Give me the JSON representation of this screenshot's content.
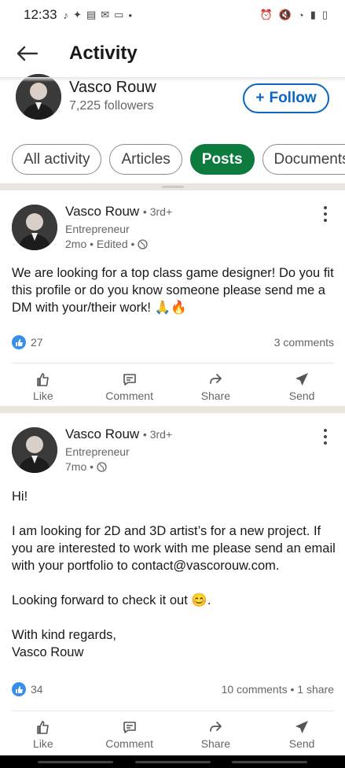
{
  "status_bar": {
    "time": "12:33"
  },
  "header": {
    "title": "Activity"
  },
  "profile": {
    "name": "Vasco Rouw",
    "followers": "7,225 followers",
    "follow_label": "Follow"
  },
  "filters": [
    {
      "label": "All activity",
      "active": false
    },
    {
      "label": "Articles",
      "active": false
    },
    {
      "label": "Posts",
      "active": true
    },
    {
      "label": "Documents",
      "active": false
    }
  ],
  "posts": [
    {
      "author": "Vasco Rouw",
      "degree": "• 3rd+",
      "headline": "Entrepreneur",
      "meta": "2mo • Edited •",
      "text": "We are looking for a top class game designer! Do you fit this profile or do you know someone please send me a DM with your/their work! 🙏🔥",
      "reactions": "27",
      "comments": "3 comments"
    },
    {
      "author": "Vasco Rouw",
      "degree": "• 3rd+",
      "headline": "Entrepreneur",
      "meta": "7mo •",
      "text": "Hi!\n\nI am looking for 2D and 3D artist’s for a new project. If you are interested to work with me please send an email with your portfolio to contact@vascorouw.com.\n\nLooking forward to check it out 😊.\n\nWith kind regards,\nVasco Rouw",
      "reactions": "34",
      "comments": "10 comments • 1 share"
    }
  ],
  "actions": {
    "like": "Like",
    "comment": "Comment",
    "share": "Share",
    "send": "Send"
  },
  "colors": {
    "brand_blue": "#0a66c2",
    "active_chip": "#0d7a3e",
    "like_blue": "#378fe9"
  }
}
